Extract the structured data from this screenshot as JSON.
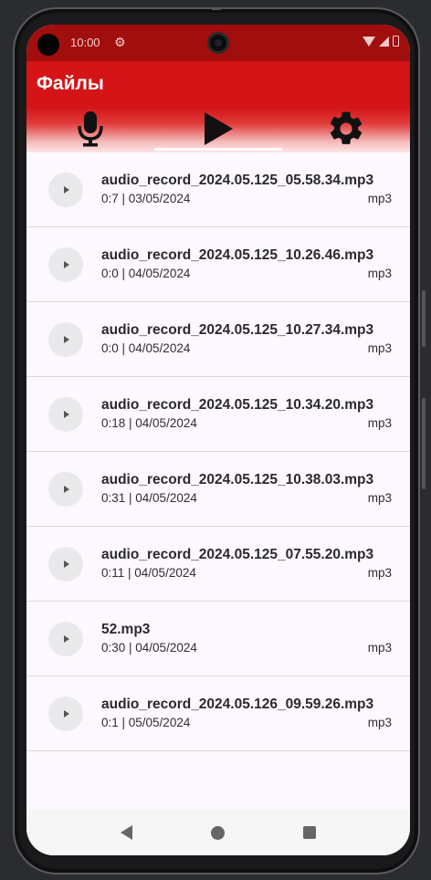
{
  "status_bar": {
    "time": "10:00"
  },
  "app": {
    "title": "Файлы"
  },
  "tabs": [
    {
      "icon": "mic-icon"
    },
    {
      "icon": "play-icon",
      "active": true
    },
    {
      "icon": "settings-icon"
    }
  ],
  "files": [
    {
      "name": "audio_record_2024.05.125_05.58.34.mp3",
      "meta": "0:7 | 03/05/2024",
      "ext": "mp3"
    },
    {
      "name": "audio_record_2024.05.125_10.26.46.mp3",
      "meta": "0:0 | 04/05/2024",
      "ext": "mp3"
    },
    {
      "name": "audio_record_2024.05.125_10.27.34.mp3",
      "meta": "0:0 | 04/05/2024",
      "ext": "mp3"
    },
    {
      "name": "audio_record_2024.05.125_10.34.20.mp3",
      "meta": "0:18 | 04/05/2024",
      "ext": "mp3"
    },
    {
      "name": "audio_record_2024.05.125_10.38.03.mp3",
      "meta": "0:31 | 04/05/2024",
      "ext": "mp3"
    },
    {
      "name": "audio_record_2024.05.125_07.55.20.mp3",
      "meta": "0:11 | 04/05/2024",
      "ext": "mp3"
    },
    {
      "name": "52.mp3",
      "meta": "0:30 | 04/05/2024",
      "ext": "mp3"
    },
    {
      "name": "audio_record_2024.05.126_09.59.26.mp3",
      "meta": "0:1 | 05/05/2024",
      "ext": "mp3"
    }
  ],
  "colors": {
    "accent": "#d41417",
    "status_bar": "#a00e0e",
    "background": "#fdf7ff"
  }
}
